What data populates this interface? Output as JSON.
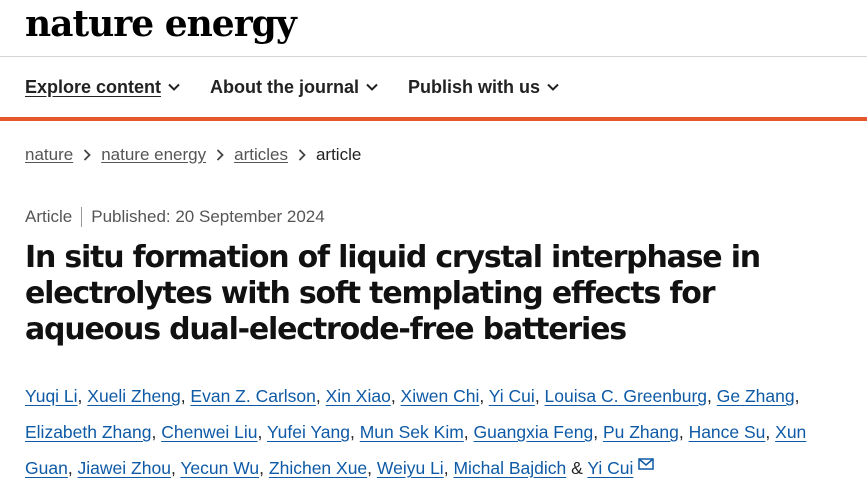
{
  "brand": {
    "logo_text": "nature energy"
  },
  "nav": [
    {
      "label": "Explore content",
      "icon": "chevron-down-icon"
    },
    {
      "label": "About the journal",
      "icon": "chevron-down-icon"
    },
    {
      "label": "Publish with us",
      "icon": "chevron-down-icon"
    }
  ],
  "colors": {
    "accent": "#e4582b",
    "link": "#0e5aa6"
  },
  "breadcrumb": {
    "items": [
      "nature",
      "nature energy",
      "articles"
    ],
    "current": "article"
  },
  "article": {
    "type": "Article",
    "published": "Published: 20 September 2024",
    "title": "In situ formation of liquid crystal interphase in electrolytes with soft templating effects for aqueous dual-electrode-free batteries",
    "authors": [
      "Yuqi Li",
      "Xueli Zheng",
      "Evan Z. Carlson",
      "Xin Xiao",
      "Xiwen Chi",
      "Yi Cui",
      "Louisa C. Greenburg",
      "Ge Zhang",
      "Elizabeth Zhang",
      "Chenwei Liu",
      "Yufei Yang",
      "Mun Sek Kim",
      "Guangxia Feng",
      "Pu Zhang",
      "Hance Su",
      "Xun Guan",
      "Jiawei Zhou",
      "Yecun Wu",
      "Zhichen Xue",
      "Weiyu Li",
      "Michal Bajdich",
      "Yi Cui"
    ],
    "author_separator": ", ",
    "last_joiner": " & ",
    "corresponding_icon": "mail-icon"
  }
}
